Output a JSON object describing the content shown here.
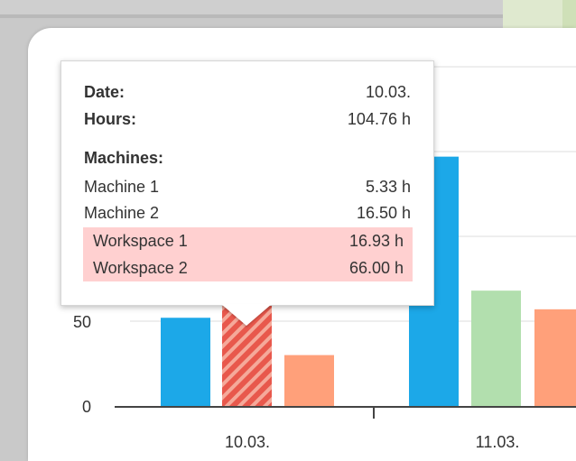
{
  "tooltip": {
    "date_label": "Date:",
    "date_value": "10.03.",
    "hours_label": "Hours:",
    "hours_value": "104.76 h",
    "machines_heading": "Machines:",
    "rows": [
      {
        "label": "Machine 1",
        "value": "5.33 h",
        "highlight": false
      },
      {
        "label": "Machine 2",
        "value": "16.50 h",
        "highlight": false
      },
      {
        "label": "Workspace 1",
        "value": "16.93 h",
        "highlight": true
      },
      {
        "label": "Workspace 2",
        "value": "66.00 h",
        "highlight": true
      }
    ],
    "highlight_color": "#ffd0d0"
  },
  "chart_data": {
    "type": "bar",
    "categories": [
      "10.03.",
      "11.03."
    ],
    "y_ticks": [
      0,
      50
    ],
    "ylim": [
      0,
      125
    ],
    "series_colors": [
      "#1ca8e8",
      "#e8584c",
      "#ffa07a",
      "#b2dfae"
    ],
    "bars": [
      {
        "category": "10.03.",
        "color": "#1ca8e8",
        "value": 52,
        "pattern": "solid"
      },
      {
        "category": "10.03.",
        "color": "#e8584c",
        "value": 66.0,
        "pattern": "striped"
      },
      {
        "category": "10.03.",
        "color": "#ffa07a",
        "value": 30,
        "pattern": "solid"
      },
      {
        "category": "11.03.",
        "color": "#1ca8e8",
        "value": 147,
        "pattern": "solid"
      },
      {
        "category": "11.03.",
        "color": "#b2dfae",
        "value": 68,
        "pattern": "solid"
      },
      {
        "category": "11.03.",
        "color": "#ffa07a",
        "value": 57,
        "pattern": "solid"
      }
    ]
  }
}
